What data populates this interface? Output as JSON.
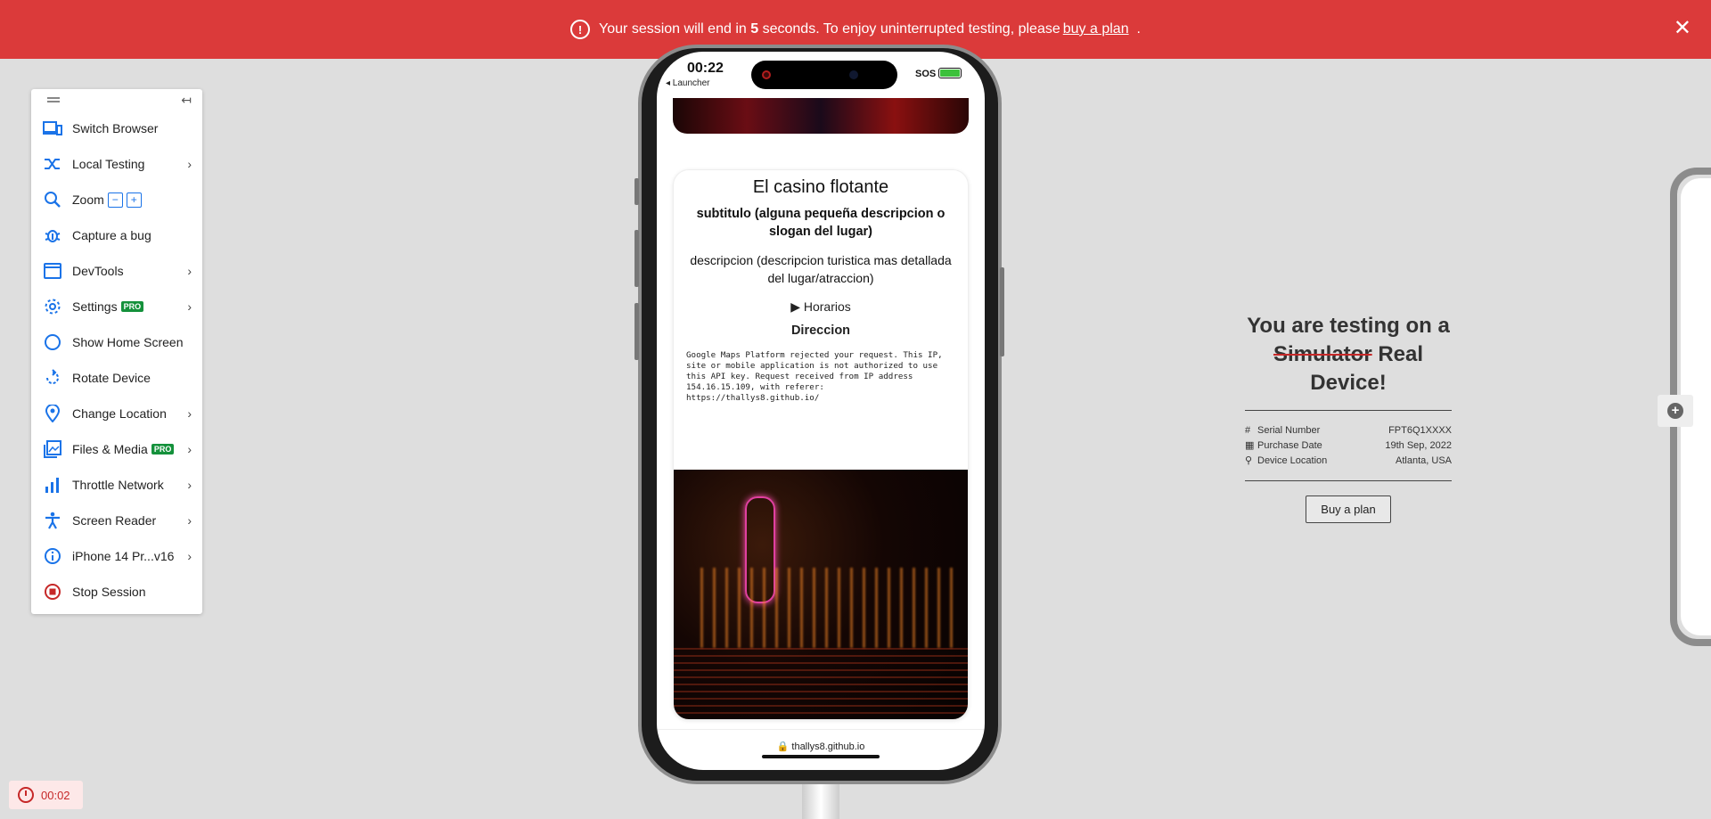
{
  "banner": {
    "text_before": "Your session will end in",
    "seconds": "5",
    "text_middle": "seconds. To enjoy uninterrupted testing, please",
    "link": "buy a plan",
    "text_after": "."
  },
  "toolbar": {
    "items": [
      {
        "label": "Switch Browser",
        "icon": "switch-browser-icon"
      },
      {
        "label": "Local Testing",
        "icon": "shuffle-icon"
      },
      {
        "label": "Zoom",
        "icon": "zoom-icon"
      },
      {
        "label": "Capture a bug",
        "icon": "bug-icon"
      },
      {
        "label": "DevTools",
        "icon": "window-icon"
      },
      {
        "label": "Settings",
        "icon": "gear-icon",
        "badge": "PRO"
      },
      {
        "label": "Show Home Screen",
        "icon": "circle-icon"
      },
      {
        "label": "Rotate Device",
        "icon": "rotate-icon"
      },
      {
        "label": "Change Location",
        "icon": "location-pin-icon"
      },
      {
        "label": "Files & Media",
        "icon": "image-icon",
        "badge": "PRO"
      },
      {
        "label": "Throttle Network",
        "icon": "bar-chart-icon"
      },
      {
        "label": "Screen Reader",
        "icon": "accessibility-icon"
      },
      {
        "label": "iPhone 14 Pr...v16",
        "icon": "info-icon"
      },
      {
        "label": "Stop Session",
        "icon": "stop-icon"
      }
    ],
    "zoom_minus": "−",
    "zoom_plus": "+"
  },
  "timer": {
    "value": "00:02"
  },
  "phone": {
    "status_time": "00:22",
    "launcher": "◂ Launcher",
    "sos": "SOS",
    "card": {
      "title": "El casino flotante",
      "subtitle": "subtitulo (alguna pequeña descripcion o slogan del lugar)",
      "description": "descripcion (descripcion turistica mas detallada del lugar/atraccion)",
      "schedule": "▶ Horarios",
      "direction": "Direccion",
      "map_error": "Google Maps Platform rejected your request. This IP, site or mobile application is not authorized to use this API key. Request received from IP address 154.16.15.109, with referer: https://thallys8.github.io/"
    },
    "url": "🔒 thallys8.github.io"
  },
  "info": {
    "title_line1": "You are testing on a",
    "struck": "Simulator",
    "title_line2_rest": " Real Device!",
    "rows": [
      {
        "icon": "#",
        "label": "Serial Number",
        "value": "FPT6Q1XXXX"
      },
      {
        "icon": "▦",
        "label": "Purchase Date",
        "value": "19th Sep, 2022"
      },
      {
        "icon": "⚲",
        "label": "Device Location",
        "value": "Atlanta, USA"
      }
    ],
    "buy_button": "Buy a plan"
  },
  "colors": {
    "banner": "#db3a3a",
    "accent": "#1a73e8",
    "pro": "#14913b",
    "stop": "#c62828"
  }
}
